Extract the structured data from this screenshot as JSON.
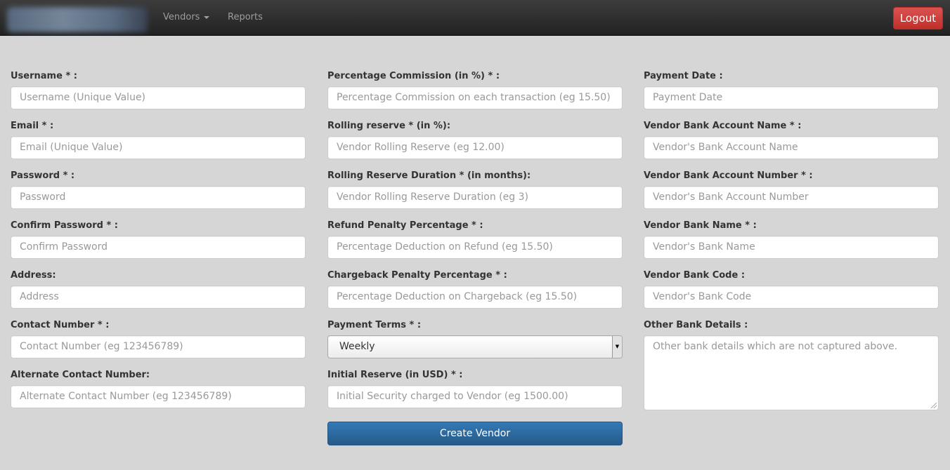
{
  "navbar": {
    "vendors_label": "Vendors",
    "reports_label": "Reports",
    "logout_label": "Logout"
  },
  "left": {
    "username": {
      "label": "Username * :",
      "placeholder": "Username (Unique Value)"
    },
    "email": {
      "label": "Email * :",
      "placeholder": "Email (Unique Value)"
    },
    "password": {
      "label": "Password * :",
      "placeholder": "Password"
    },
    "confirm_password": {
      "label": "Confirm Password * :",
      "placeholder": "Confirm Password"
    },
    "address": {
      "label": "Address:",
      "placeholder": "Address"
    },
    "contact_number": {
      "label": "Contact Number * :",
      "placeholder": "Contact Number (eg 123456789)"
    },
    "alternate_contact": {
      "label": "Alternate Contact Number:",
      "placeholder": "Alternate Contact Number (eg 123456789)"
    }
  },
  "middle": {
    "commission": {
      "label": "Percentage Commission (in %) * :",
      "placeholder": "Percentage Commission on each transaction (eg 15.50)"
    },
    "rolling_reserve": {
      "label": "Rolling reserve * (in %):",
      "placeholder": "Vendor Rolling Reserve (eg 12.00)"
    },
    "rolling_duration": {
      "label": "Rolling Reserve Duration * (in months):",
      "placeholder": "Vendor Rolling Reserve Duration (eg 3)"
    },
    "refund_penalty": {
      "label": "Refund Penalty Percentage * :",
      "placeholder": "Percentage Deduction on Refund (eg 15.50)"
    },
    "chargeback_penalty": {
      "label": "Chargeback Penalty Percentage * :",
      "placeholder": "Percentage Deduction on Chargeback (eg 15.50)"
    },
    "payment_terms": {
      "label": "Payment Terms * :",
      "value": "Weekly"
    },
    "initial_reserve": {
      "label": "Initial Reserve (in USD) * :",
      "placeholder": "Initial Security charged to Vendor (eg 1500.00)"
    },
    "submit_label": "Create Vendor"
  },
  "right": {
    "payment_date": {
      "label": "Payment Date :",
      "placeholder": "Payment Date"
    },
    "bank_account_name": {
      "label": "Vendor Bank Account Name * :",
      "placeholder": "Vendor's Bank Account Name"
    },
    "bank_account_number": {
      "label": "Vendor Bank Account Number * :",
      "placeholder": "Vendor's Bank Account Number"
    },
    "bank_name": {
      "label": "Vendor Bank Name * :",
      "placeholder": "Vendor's Bank Name"
    },
    "bank_code": {
      "label": "Vendor Bank Code :",
      "placeholder": "Vendor's Bank Code"
    },
    "other_details": {
      "label": "Other Bank Details :",
      "placeholder": "Other bank details which are not captured above."
    }
  },
  "colors": {
    "navbar": "#222222",
    "logout": "#d9534f",
    "primary": "#337ab7",
    "background": "#d6d6d6"
  }
}
